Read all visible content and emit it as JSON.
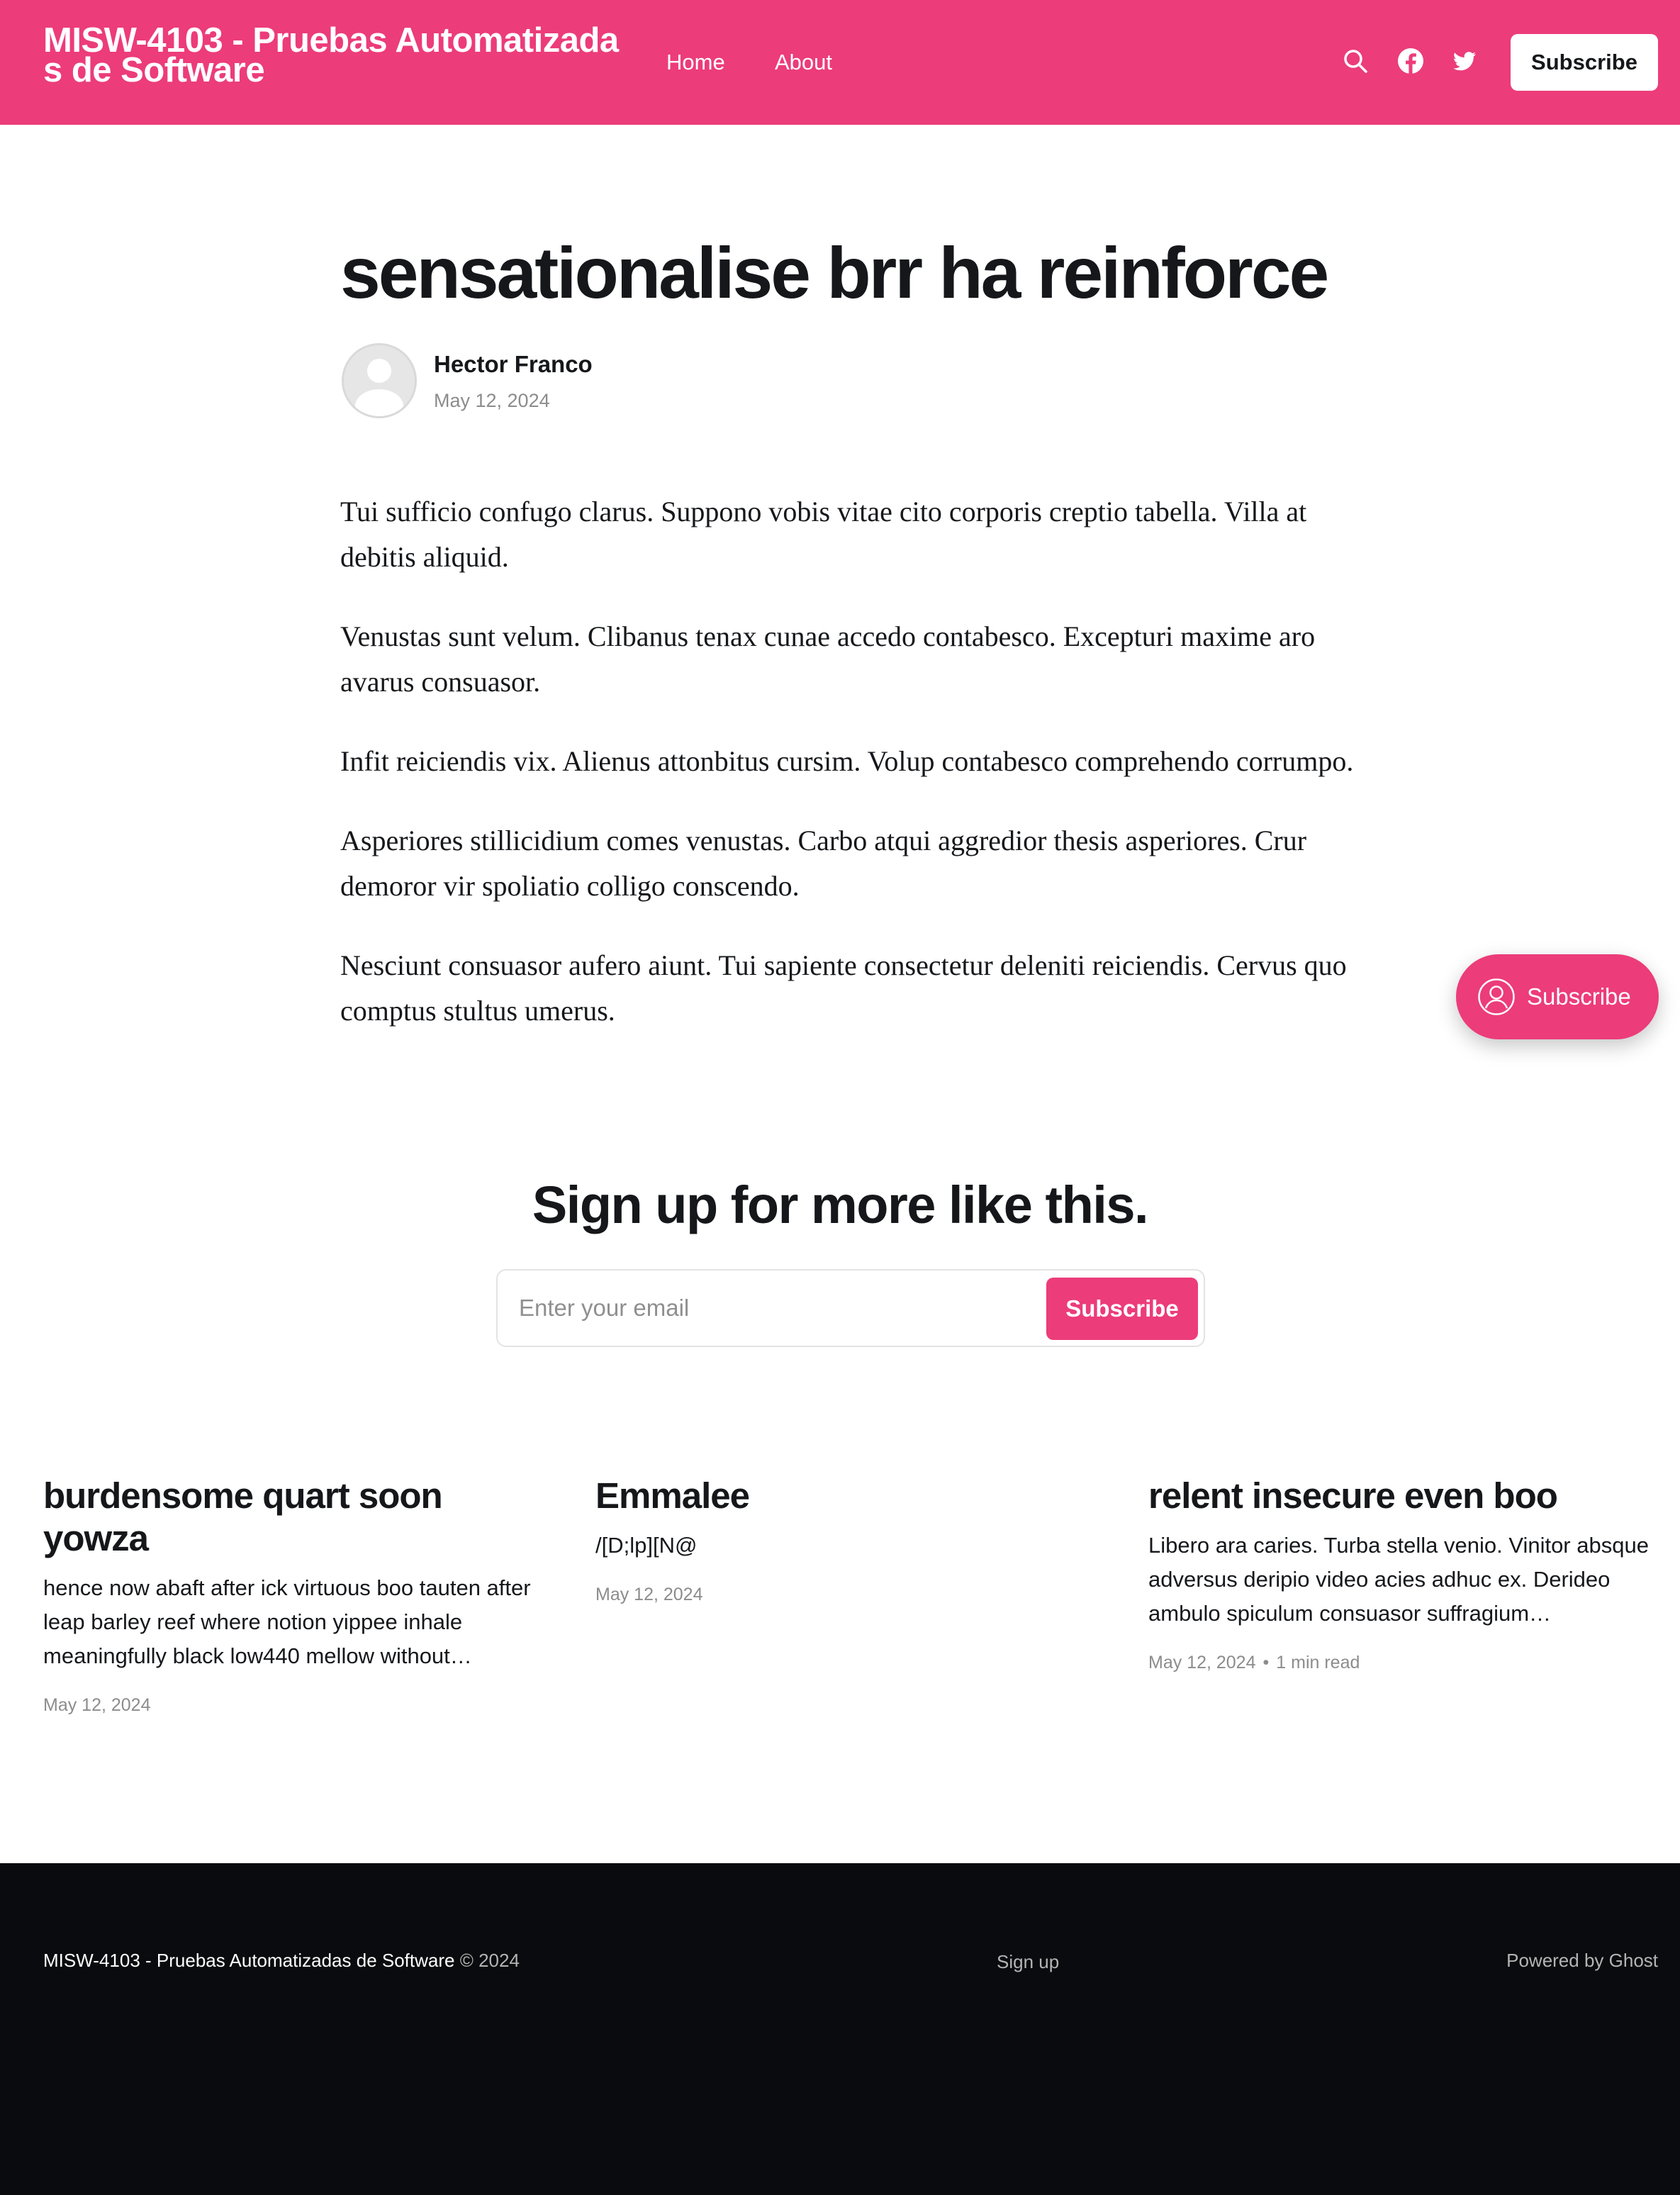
{
  "header": {
    "site_title": "MISW-4103 - Pruebas Automatizadas de Software",
    "nav": [
      {
        "label": "Home"
      },
      {
        "label": "About"
      }
    ],
    "icons": [
      "search-icon",
      "facebook-icon",
      "twitter-icon"
    ],
    "subscribe_label": "Subscribe"
  },
  "post": {
    "title": "sensationalise brr ha reinforce",
    "author": "Hector Franco",
    "date": "May 12, 2024",
    "paragraphs": [
      "Tui sufficio confugo clarus. Suppono vobis vitae cito corporis creptio tabella. Villa at debitis aliquid.",
      "Venustas sunt velum. Clibanus tenax cunae accedo contabesco. Excepturi maxime aro avarus consuasor.",
      "Infit reiciendis vix. Alienus attonbitus cursim. Volup contabesco comprehendo corrumpo.",
      "Asperiores stillicidium comes venustas. Carbo atqui aggredior thesis asperiores. Crur demoror vir spoliatio colligo conscendo.",
      "Nesciunt consuasor aufero aiunt. Tui sapiente consectetur deleniti reiciendis. Cervus quo comptus stultus umerus."
    ]
  },
  "signup": {
    "title": "Sign up for more like this.",
    "email_placeholder": "Enter your email",
    "button_label": "Subscribe"
  },
  "portal": {
    "label": "Subscribe"
  },
  "related": [
    {
      "title": "burdensome quart soon yowza",
      "excerpt": "hence now abaft after ick virtuous boo tauten after leap barley reef where notion yippee inhale meaningfully black low440 mellow without…",
      "date": "May 12, 2024",
      "reading_time": ""
    },
    {
      "title": "Emmalee",
      "excerpt": "/[D;lp][N@",
      "date": "May 12, 2024",
      "reading_time": ""
    },
    {
      "title": "relent insecure even boo",
      "excerpt": "Libero ara caries. Turba stella venio. Vinitor absque adversus deripio video acies adhuc ex. Derideo ambulo spiculum consuasor suffragium…",
      "date": "May 12, 2024",
      "reading_time": "1 min read"
    }
  ],
  "footer": {
    "site_name": "MISW-4103 - Pruebas Automatizadas de Software",
    "copyright": "© 2024",
    "signup_link": "Sign up",
    "powered_by": "Powered by Ghost"
  },
  "colors": {
    "accent": "#ec3c7a",
    "text": "#15171a",
    "muted": "#8c8c8c",
    "footer_bg": "#0a0b0e"
  }
}
